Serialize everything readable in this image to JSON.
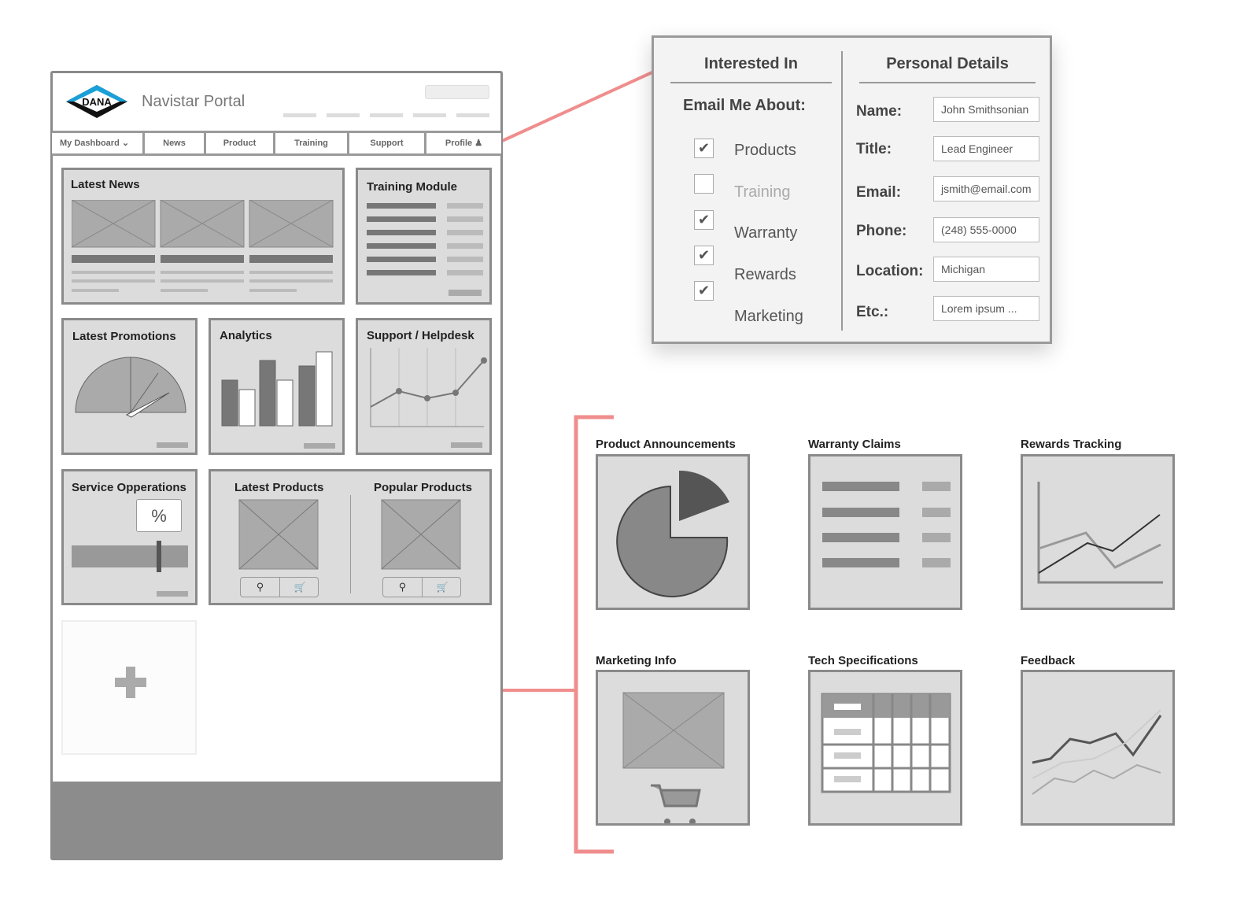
{
  "portal": {
    "logo_text": "DANA",
    "title": "Navistar Portal",
    "nav": [
      {
        "label": "My Dashboard"
      },
      {
        "label": "News"
      },
      {
        "label": "Product"
      },
      {
        "label": "Training"
      },
      {
        "label": "Support"
      },
      {
        "label": "Profile"
      }
    ],
    "cards": {
      "latest_news": "Latest News",
      "training_module": "Training Module",
      "latest_promotions": "Latest Promotions",
      "analytics": "Analytics",
      "support_helpdesk": "Support / Helpdesk",
      "service_operations": "Service Opperations",
      "percent_symbol": "%",
      "latest_products": "Latest Products",
      "popular_products": "Popular Products"
    }
  },
  "profile_panel": {
    "interested_in": "Interested In",
    "email_me_about": "Email Me About:",
    "options": [
      {
        "label": "Products",
        "checked": true
      },
      {
        "label": "Training",
        "checked": false
      },
      {
        "label": "Warranty",
        "checked": true
      },
      {
        "label": "Rewards",
        "checked": true
      },
      {
        "label": "Marketing",
        "checked": true
      }
    ],
    "personal_details": "Personal Details",
    "fields": [
      {
        "label": "Name:",
        "value": "John Smithsonian"
      },
      {
        "label": "Title:",
        "value": "Lead Engineer"
      },
      {
        "label": "Email:",
        "value": "jsmith@email.com"
      },
      {
        "label": "Phone:",
        "value": "(248) 555-0000"
      },
      {
        "label": "Location:",
        "value": "Michigan"
      },
      {
        "label": "Etc.:",
        "value": "Lorem ipsum ..."
      }
    ]
  },
  "widgets": [
    {
      "title": "Product Announcements"
    },
    {
      "title": "Warranty Claims"
    },
    {
      "title": "Rewards Tracking"
    },
    {
      "title": "Marketing Info"
    },
    {
      "title": "Tech Specifications"
    },
    {
      "title": "Feedback"
    }
  ],
  "colors": {
    "connector": "#f08d8d",
    "frame": "#8a8a8a",
    "card": "#dcdcdc"
  }
}
